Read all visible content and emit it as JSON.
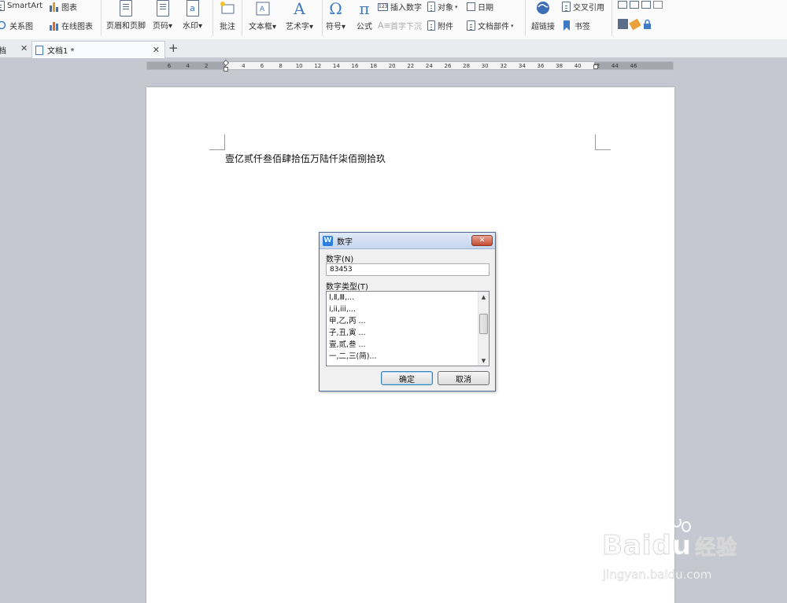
{
  "ribbon": {
    "smartart": "SmartArt",
    "chart": "图表",
    "relation_chart": "关系图",
    "online_chart": "在线图表",
    "header_footer": "页眉和页脚",
    "page_number": "页码",
    "watermark": "水印",
    "comment": "批注",
    "textbox": "文本框",
    "wordart": "艺术字",
    "symbol": "符号",
    "formula": "公式",
    "insert_number": "插入数字",
    "drop_cap": "首字下沉",
    "object": "对象",
    "attachment": "附件",
    "date": "日期",
    "doc_parts": "文档部件",
    "hyperlink": "超链接",
    "cross_reference": "交叉引用",
    "bookmark": "书签"
  },
  "tabs": {
    "left_partial": "档",
    "active": "文档1 *"
  },
  "ruler": {
    "ticks": [
      "6",
      "4",
      "2",
      "2",
      "4",
      "6",
      "8",
      "10",
      "12",
      "14",
      "16",
      "18",
      "20",
      "22",
      "24",
      "26",
      "28",
      "30",
      "32",
      "34",
      "36",
      "38",
      "40",
      "42",
      "44",
      "46"
    ]
  },
  "document": {
    "text": "壹亿贰仟叁佰肆拾伍万陆仟柒佰捌拾玖"
  },
  "dialog": {
    "title": "数字",
    "close": "✕",
    "number_label": "数字(N)",
    "number_value": "83453",
    "type_label": "数字类型(T)",
    "types": [
      "Ⅰ,Ⅱ,Ⅲ,...",
      "i,ii,iii,...",
      "甲,乙,丙 ...",
      "子,丑,寅 ...",
      "壹,贰,叁 ...",
      "一,二,三(简)..."
    ],
    "ok": "确定",
    "cancel": "取消"
  },
  "watermark": {
    "brand": "Bai",
    "brand2": "du",
    "product": "经验",
    "url": "jingyan.baidu.com"
  },
  "colors": {
    "accent": "#2c7de0",
    "dialog_border": "#4d6d9a",
    "close_red": "#c44c32"
  }
}
